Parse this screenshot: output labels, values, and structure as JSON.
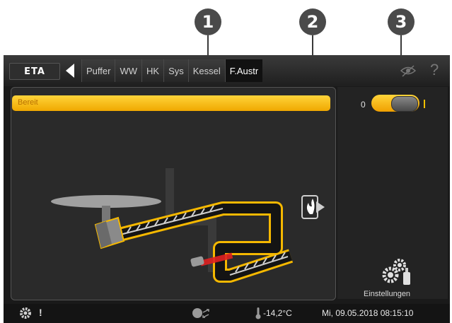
{
  "callouts": [
    "1",
    "2",
    "3"
  ],
  "logo": "ETA",
  "tabs": [
    "Puffer",
    "WW",
    "HK",
    "Sys",
    "Kessel",
    "F.Austr"
  ],
  "active_tab": "F.Austr",
  "status": "Bereit",
  "toggle": {
    "off_label": "0",
    "state": "on"
  },
  "settings_label": "Einstellungen",
  "bottom": {
    "temperature": "-14,2°C",
    "datetime": "Mi, 09.05.2018 08:15:10"
  },
  "colors": {
    "accent": "#f5b800",
    "background": "#1a1a1a",
    "feed_light": "#e02020"
  }
}
